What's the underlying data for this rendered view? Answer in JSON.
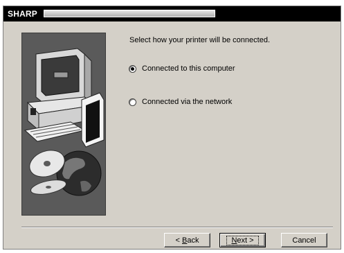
{
  "titlebar": {
    "title": "SHARP"
  },
  "main": {
    "prompt": "Select how your printer will be connected."
  },
  "options": [
    {
      "label": "Connected to this computer",
      "selected": true
    },
    {
      "label": "Connected via the network",
      "selected": false
    }
  ],
  "buttons": {
    "back": {
      "prefix": "< ",
      "accel": "B",
      "rest": "ack"
    },
    "next": {
      "accel": "N",
      "rest": "ext >"
    },
    "cancel": "Cancel"
  },
  "colors": {
    "titlebar": "#000000",
    "dialog": "#d4d0c8",
    "side_panel": "#5a5a5a"
  }
}
